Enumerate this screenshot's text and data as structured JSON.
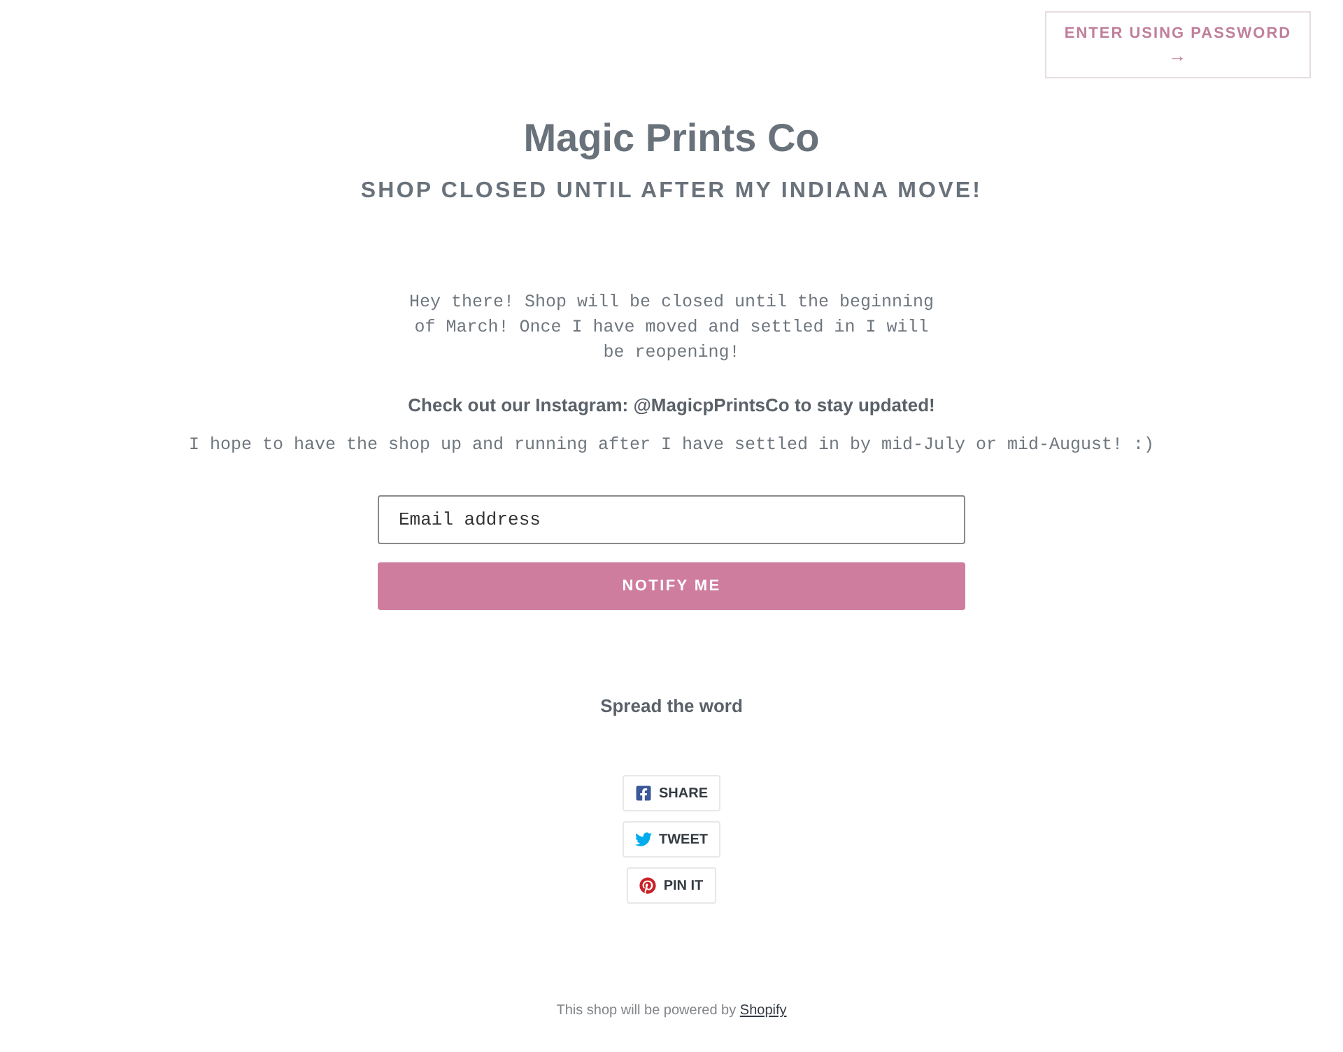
{
  "header": {
    "password_button": {
      "label": "ENTER USING PASSWORD",
      "arrow": "→"
    }
  },
  "title": "Magic Prints Co",
  "subtitle": "SHOP CLOSED UNTIL AFTER MY INDIANA MOVE!",
  "message": {
    "intro": "Hey there! Shop will be closed until the beginning of March! Once I have moved and settled in I will be reopening!",
    "instagram": "Check out our Instagram: @MagicpPrintsCo to stay updated!",
    "note": "I hope to have the shop up and running after I have settled in by mid-July or mid-August! :)"
  },
  "signup": {
    "email_field": {
      "placeholder": "Email address"
    },
    "submit_button": "NOTIFY ME"
  },
  "share": {
    "heading": "Spread the word",
    "buttons": [
      {
        "kind": "facebook",
        "label": "SHARE"
      },
      {
        "kind": "twitter",
        "label": "TWEET"
      },
      {
        "kind": "pinterest",
        "label": "PIN IT"
      }
    ]
  },
  "footer": {
    "text": "This shop will be powered by",
    "link": "Shopify"
  }
}
